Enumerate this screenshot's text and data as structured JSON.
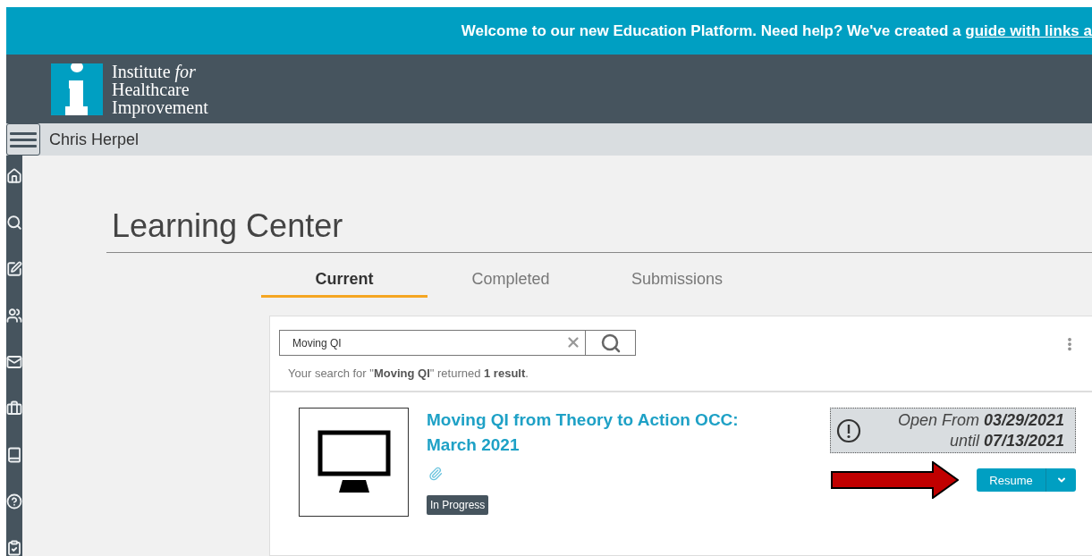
{
  "banner": {
    "text": "Welcome to our new Education Platform. Need help? We've created a ",
    "link": "guide with links a"
  },
  "logo": {
    "lines": [
      "Institute *for*",
      "Healthcare",
      "Improvement"
    ]
  },
  "user_bar": {
    "name": "Chris Herpel"
  },
  "sidebar": {
    "items": [
      {
        "kind": "home"
      },
      {
        "kind": "search"
      },
      {
        "kind": "edit"
      },
      {
        "kind": "users"
      },
      {
        "kind": "mail"
      },
      {
        "kind": "briefcase"
      },
      {
        "kind": "book"
      },
      {
        "kind": "help"
      },
      {
        "kind": "clipboard"
      }
    ]
  },
  "page_title": "Learning Center",
  "tabs": [
    {
      "label": "Current",
      "selected": true
    },
    {
      "label": "Completed",
      "selected": false
    },
    {
      "label": "Submissions",
      "selected": false
    }
  ],
  "search": {
    "value": "Moving QI",
    "result": "Your search for \"**Moving QI**\" returned **1 result**."
  },
  "items": [
    {
      "title": "Moving QI from Theory to Action OCC: March 2021",
      "status": "In Progress",
      "availability": [
        "Open From **03/29/2021**",
        "until **07/13/2021**"
      ],
      "action": "Resume"
    }
  ]
}
